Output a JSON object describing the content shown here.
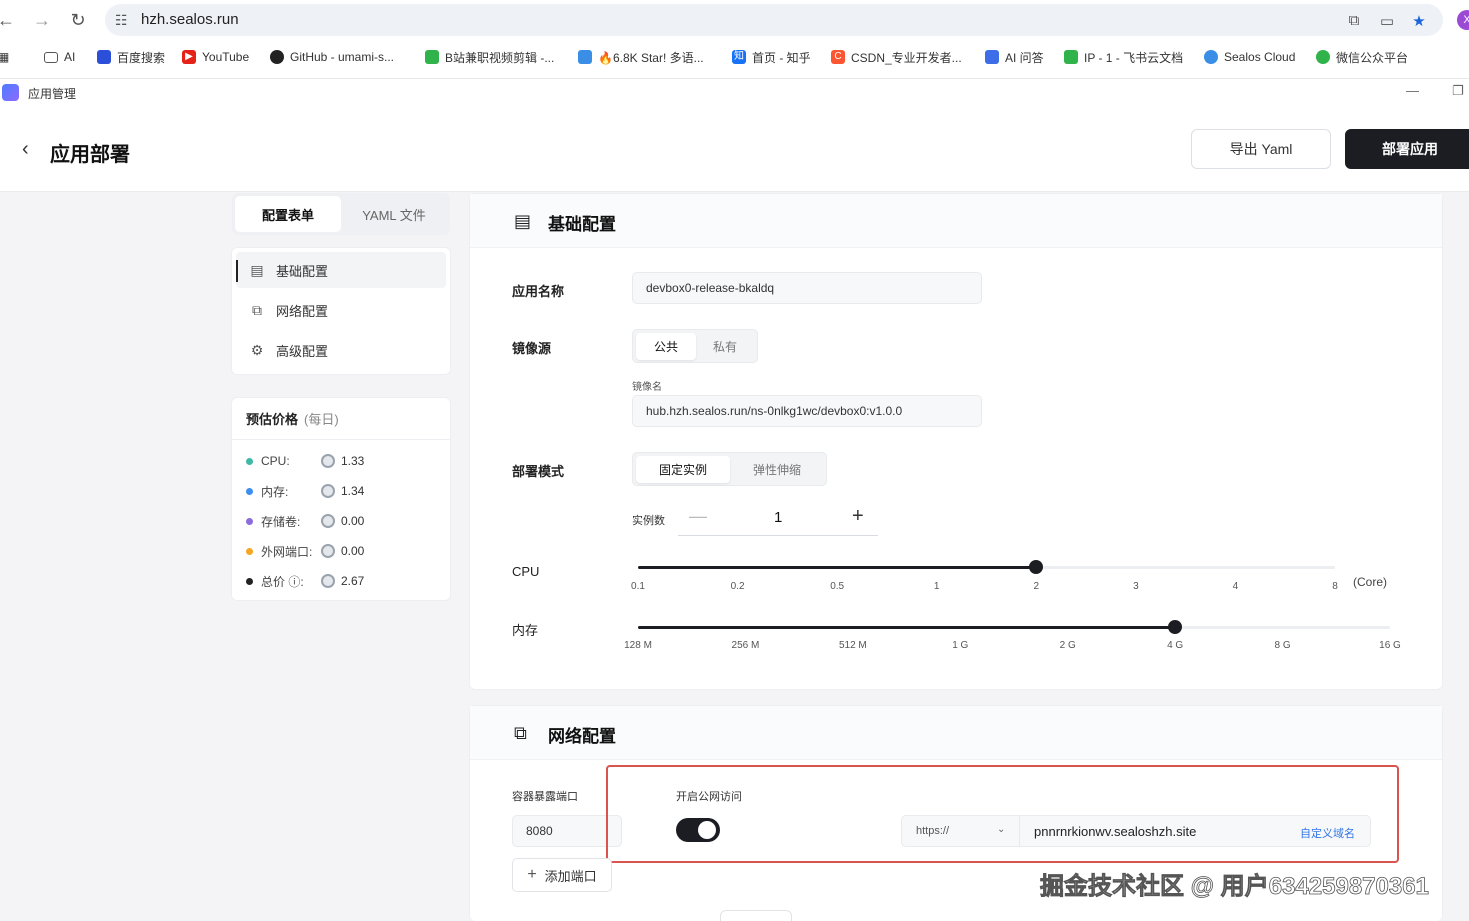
{
  "browser": {
    "url": "hzh.sealos.run",
    "bookmarks": [
      {
        "label": "AI",
        "color": "#555555"
      },
      {
        "label": "百度搜索",
        "color": "#2b4fd8"
      },
      {
        "label": "YouTube",
        "color": "#e62117"
      },
      {
        "label": "GitHub - umami-s...",
        "color": "#222222"
      },
      {
        "label": "B站兼职视频剪辑 -...",
        "color": "#2fb34a"
      },
      {
        "label": "🔥6.8K Star! 多语...",
        "color": "#3a8ee6"
      },
      {
        "label": "首页 - 知乎",
        "color": "#1772f6"
      },
      {
        "label": "CSDN_专业开发者...",
        "color": "#fc5531"
      },
      {
        "label": "AI 问答",
        "color": "#3d6ee8"
      },
      {
        "label": "IP - 1 - 飞书云文档",
        "color": "#2fb34a"
      },
      {
        "label": "Sealos Cloud",
        "color": "#3a8ee6"
      },
      {
        "label": "微信公众平台",
        "color": "#2fb34a"
      }
    ],
    "profile_initial": "X"
  },
  "app": {
    "title": "应用管理"
  },
  "header": {
    "title": "应用部署",
    "export_label": "导出 Yaml",
    "deploy_label": "部署应用"
  },
  "tabs": {
    "form_label": "配置表单",
    "yaml_label": "YAML 文件"
  },
  "side_nav": {
    "items": [
      {
        "label": "基础配置"
      },
      {
        "label": "网络配置"
      },
      {
        "label": "高级配置"
      }
    ]
  },
  "price": {
    "title": "预估价格",
    "subtitle": "(每日)",
    "rows": [
      {
        "label": "CPU:",
        "value": "1.33",
        "color": "#3fb8a8"
      },
      {
        "label": "内存:",
        "value": "1.34",
        "color": "#3b8ff0"
      },
      {
        "label": "存储卷:",
        "value": "0.00",
        "color": "#8c6bdc"
      },
      {
        "label": "外网端口:",
        "value": "0.00",
        "color": "#f5a623"
      },
      {
        "label": "总价 ⓘ:",
        "value": "2.67",
        "color": "#222222"
      }
    ]
  },
  "basic": {
    "title": "基础配置",
    "app_name_label": "应用名称",
    "app_name_value": "devbox0-release-bkaldq",
    "image_source_label": "镜像源",
    "image_public": "公共",
    "image_private": "私有",
    "image_name_label": "镜像名",
    "image_name_value": "hub.hzh.sealos.run/ns-0nlkg1wc/devbox0:v1.0.0",
    "deploy_mode_label": "部署模式",
    "mode_fixed": "固定实例",
    "mode_elastic": "弹性伸缩",
    "instances_label": "实例数",
    "instances_value": "1",
    "cpu_label": "CPU",
    "cpu_unit": "(Core)",
    "cpu_ticks": [
      "0.1",
      "0.2",
      "0.5",
      "1",
      "2",
      "3",
      "4",
      "8"
    ],
    "cpu_selected_index": 4,
    "memory_label": "内存",
    "memory_ticks": [
      "128 M",
      "256 M",
      "512 M",
      "1 G",
      "2 G",
      "4 G",
      "8 G",
      "16 G"
    ],
    "memory_selected_index": 5
  },
  "network": {
    "title": "网络配置",
    "port_label": "容器暴露端口",
    "port_value": "8080",
    "public_access_label": "开启公网访问",
    "public_access_enabled": true,
    "protocol": "https://",
    "domain": "pnnrnrkionwv.sealoshzh.site",
    "custom_domain_label": "自定义域名",
    "add_port_label": "添加端口"
  },
  "watermark": "掘金技术社区 @ 用户634259870361"
}
